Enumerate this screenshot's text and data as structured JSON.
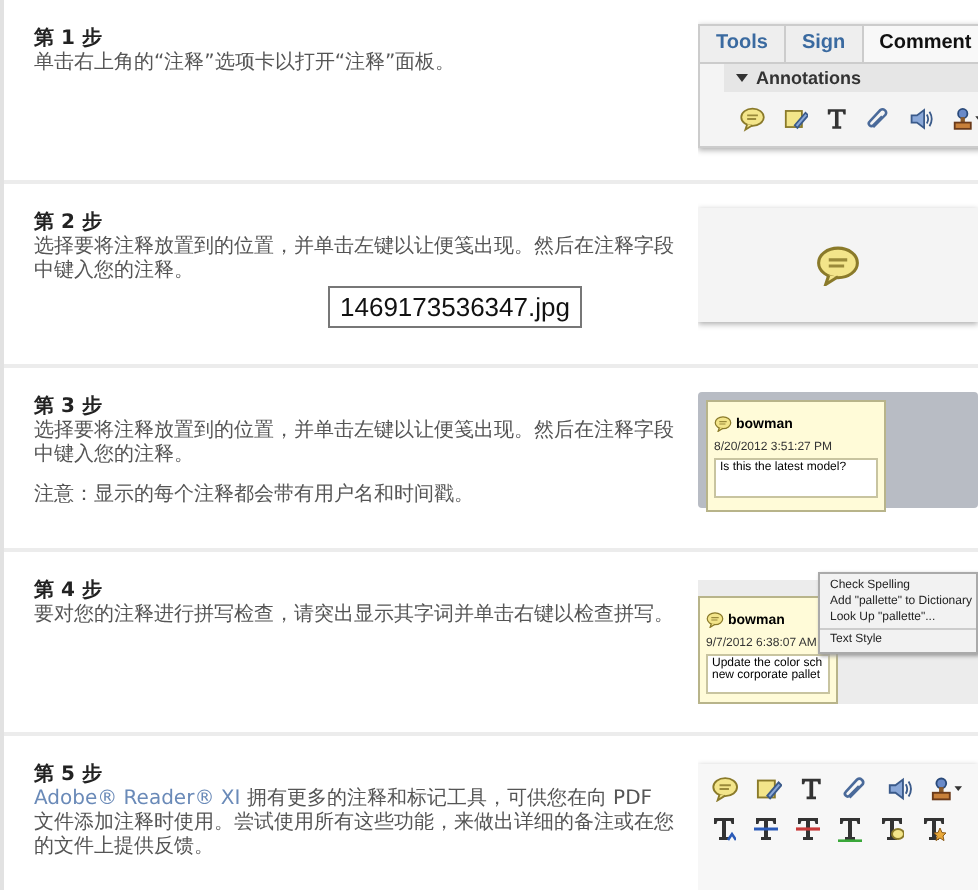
{
  "steps": [
    {
      "title": "第 1 步",
      "text": "单击右上角的“注释”选项卡以打开“注释”面板。",
      "figure": {
        "kind": "panel",
        "tabs": [
          {
            "label": "Tools",
            "selected": false
          },
          {
            "label": "Sign",
            "selected": false
          },
          {
            "label": "Comment",
            "selected": true
          }
        ],
        "section": {
          "label": "Annotations",
          "expanded": true
        }
      }
    },
    {
      "title": "第 2 步",
      "text": "选择要将注释放置到的位置，并单击左键以让便笺出现。然后在注释字段中键入您的注释。",
      "figure": {
        "kind": "bubble"
      },
      "overlay_label": "1469173536347.jpg"
    },
    {
      "title": "第 3 步",
      "text": "选择要将注释放置到的位置，并单击左键以让便笺出现。然后在注释字段中键入您的注释。",
      "note": "注意：显示的每个注释都会带有用户名和时间戳。",
      "figure": {
        "kind": "note",
        "author": "bowman",
        "timestamp": "8/20/2012 3:51:27 PM",
        "lines": [
          "Is this the latest model?"
        ]
      }
    },
    {
      "title": "第 4 步",
      "text": "要对您的注释进行拼写检查，请突出显示其字词并单击右键以检查拼写。",
      "figure": {
        "kind": "spell",
        "author": "bowman",
        "timestamp": "9/7/2012 6:38:07 AM",
        "lines": [
          "Update the color sch",
          "new corporate pallet"
        ],
        "menu": [
          "Check Spelling",
          "Add \"pallette\" to Dictionary",
          "Look Up \"pallette\"...",
          "Text Style"
        ]
      }
    },
    {
      "title": "第 5 步",
      "product": "Adobe® Reader® XI",
      "text": "拥有更多的注释和标记工具，可供您在向 PDF 文件添加注释时使用。尝试使用所有这些功能，来做出详细的备注或在您的文件上提供反馈。",
      "figure": {
        "kind": "tools"
      }
    }
  ]
}
